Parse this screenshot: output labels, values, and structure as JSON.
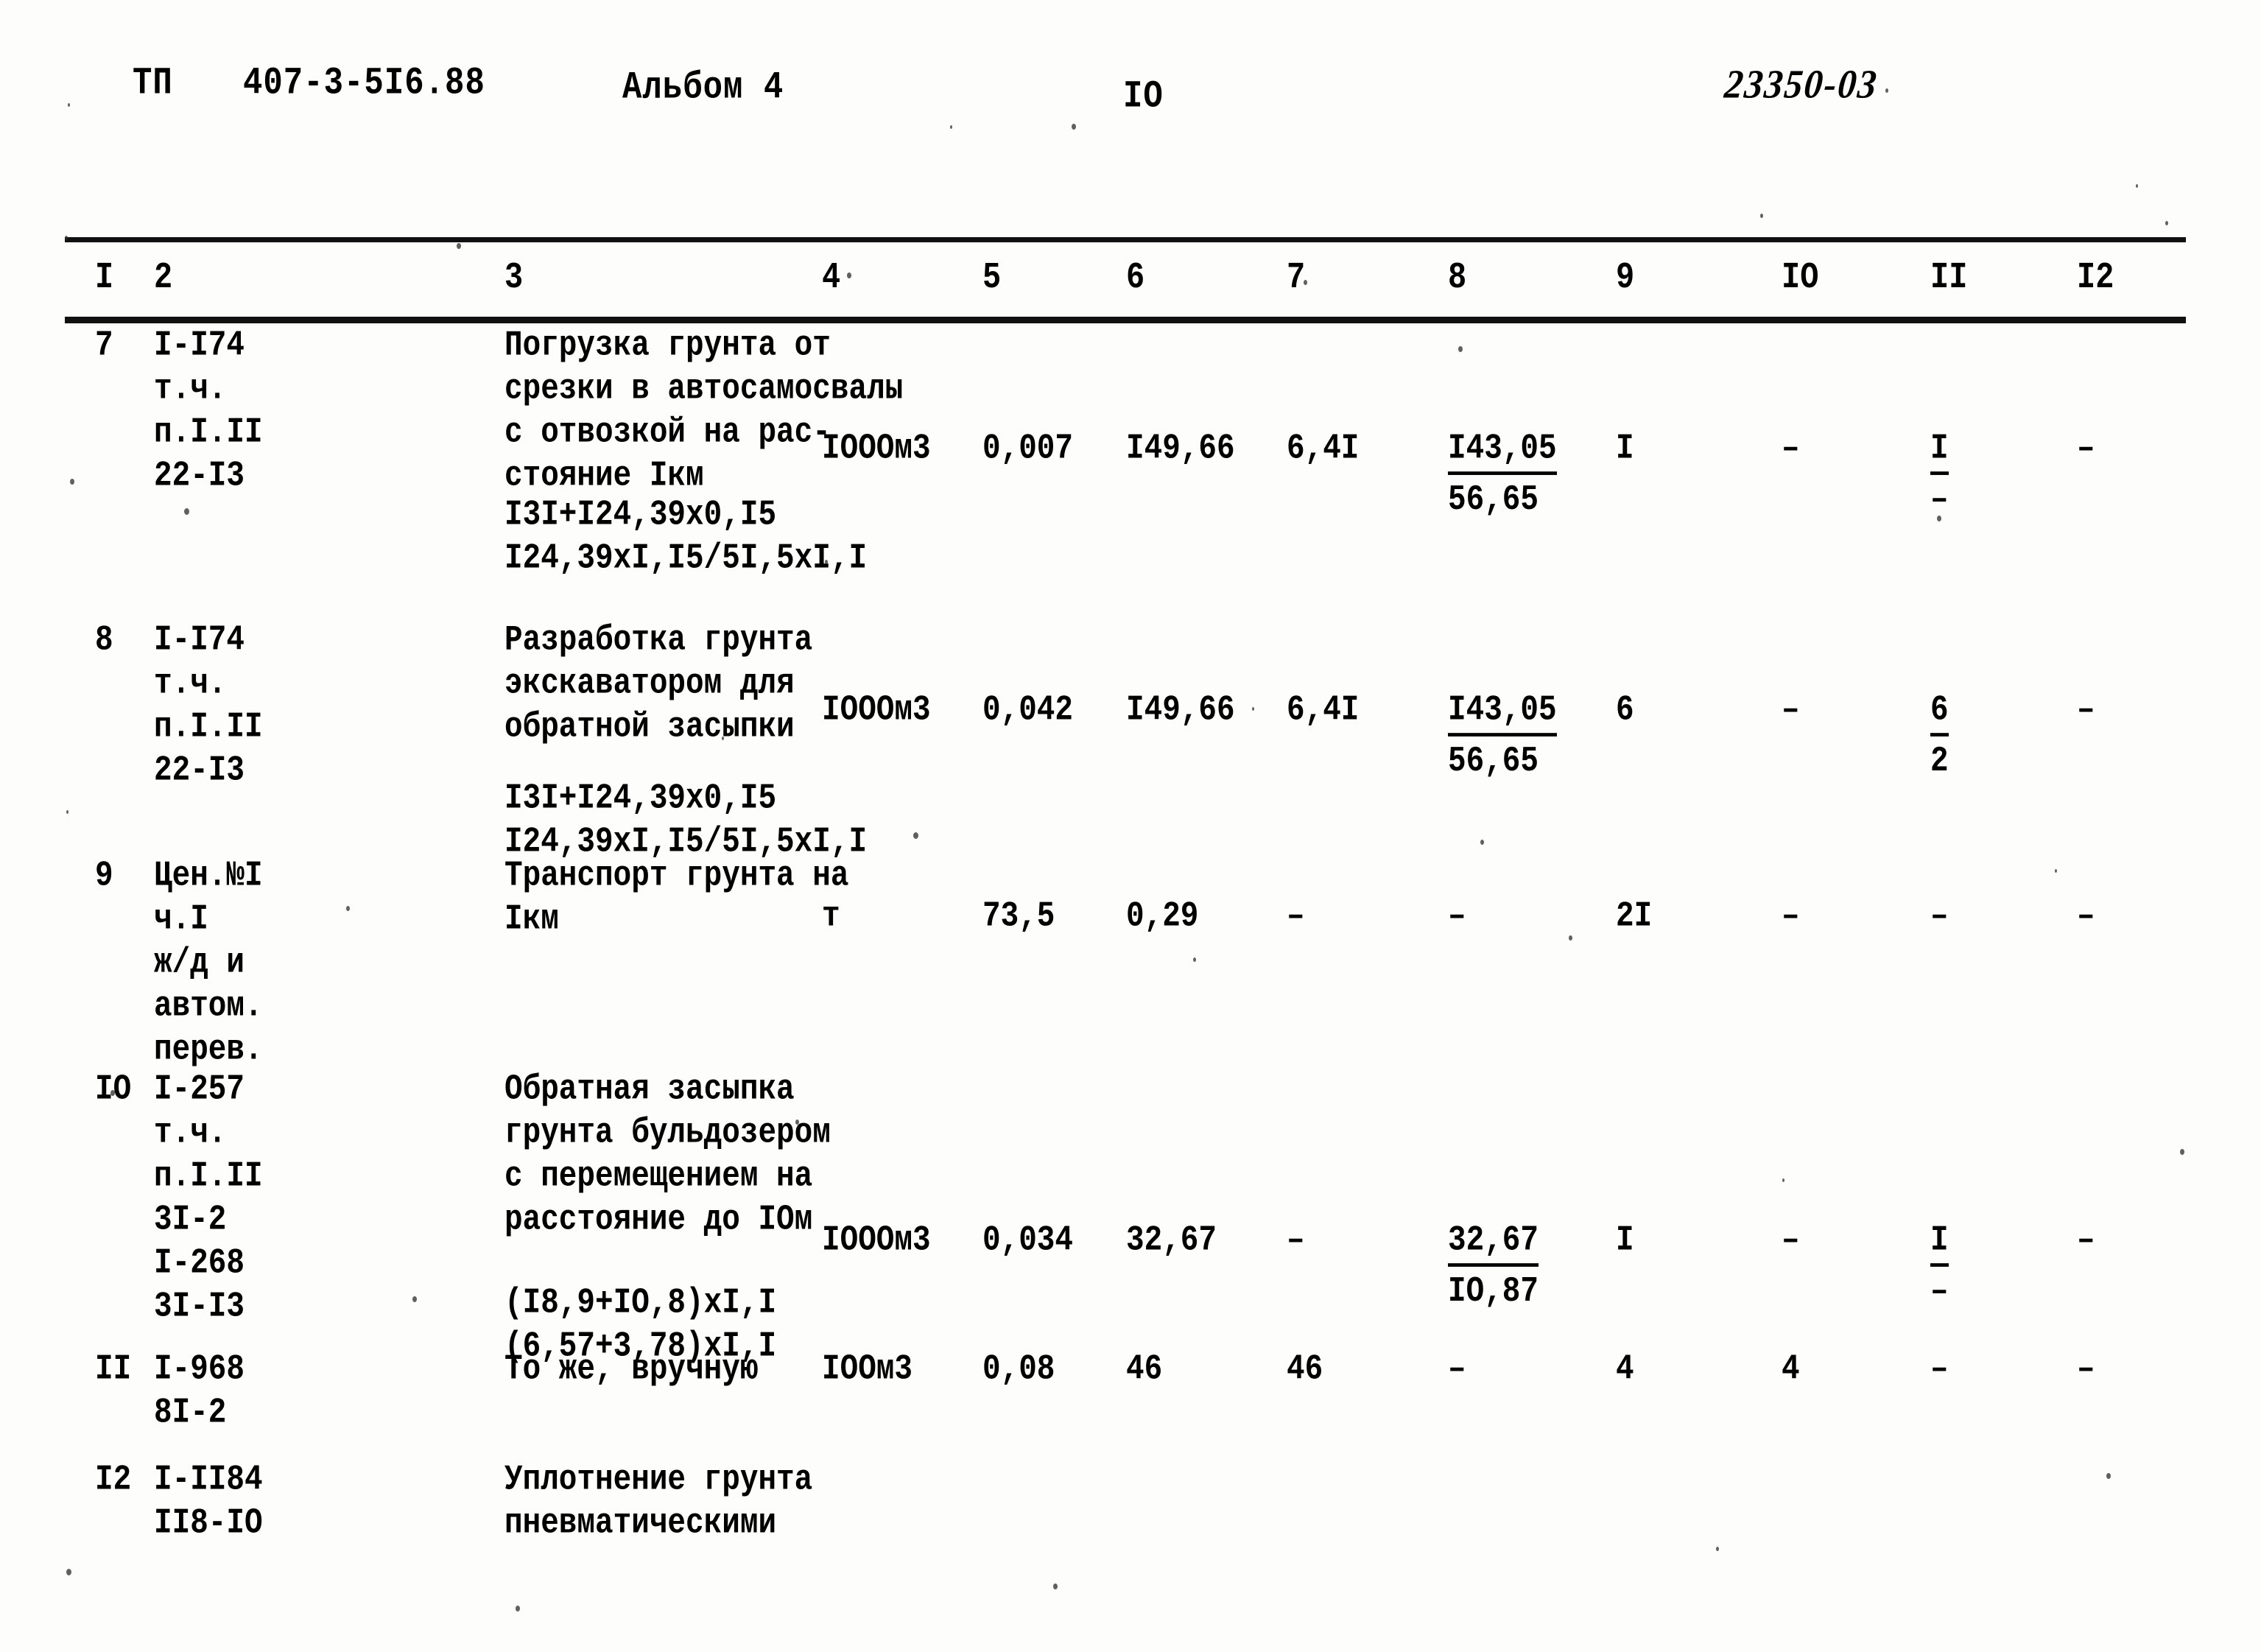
{
  "header": {
    "doc_type": "ТП",
    "doc_code": "407-3-5I6.88",
    "album": "Альбом 4",
    "page_number": "IO",
    "handwritten_mark": "23350-03"
  },
  "table": {
    "column_headers": [
      "I",
      "2",
      "3",
      "4",
      "5",
      "6",
      "7",
      "8",
      "9",
      "IO",
      "II",
      "I2"
    ],
    "rows": [
      {
        "n": "7",
        "code_lines": [
          "I-I74",
          "т.ч.",
          "п.I.II",
          "22-I3"
        ],
        "desc_lines": [
          "Погрузка грунта от",
          "срезки в автосамосвалы",
          "с отвозкой на рас-",
          "стояние Iкм"
        ],
        "formula_lines": [
          "I3I+I24,39x0,I5",
          "I24,39xI,I5/5I,5xI,I"
        ],
        "unit": "IOOOм3",
        "c5": "0,007",
        "c6": "I49,66",
        "c7": "6,4I",
        "c8_top": "I43,05",
        "c8_bot": "56,65",
        "c9": "I",
        "c10": "–",
        "c11_top": "I",
        "c11_bot": "–",
        "c12": "–"
      },
      {
        "n": "8",
        "code_lines": [
          "I-I74",
          "т.ч.",
          "п.I.II",
          "22-I3"
        ],
        "desc_lines": [
          "Разработка грунта",
          "экскаватором для",
          "обратной засыпки"
        ],
        "formula_lines": [
          "I3I+I24,39x0,I5",
          "I24,39xI,I5/5I,5xI,I"
        ],
        "unit": "IOOOм3",
        "c5": "0,042",
        "c6": "I49,66",
        "c7": "6,4I",
        "c8_top": "I43,05",
        "c8_bot": "56,65",
        "c9": "6",
        "c10": "–",
        "c11_top": "6",
        "c11_bot": "2",
        "c12": "–"
      },
      {
        "n": "9",
        "code_lines": [
          "Цен.№I",
          "ч.I",
          "ж/д и",
          "автом.",
          "перев."
        ],
        "desc_lines": [
          "Транспорт грунта на",
          "Iкм"
        ],
        "formula_lines": [],
        "unit": "т",
        "c5": "73,5",
        "c6": "0,29",
        "c7": "–",
        "c8_top": "–",
        "c8_bot": "",
        "c9": "2I",
        "c10": "–",
        "c11_top": "–",
        "c11_bot": "",
        "c12": "–"
      },
      {
        "n": "IO",
        "code_lines": [
          "I-257",
          "т.ч.",
          "п.I.II",
          "3I-2",
          "I-268",
          "3I-I3"
        ],
        "desc_lines": [
          "Обратная засыпка",
          "грунта бульдозером",
          "с перемещением на",
          "расстояние до IOм"
        ],
        "formula_lines": [
          "(I8,9+IO,8)xI,I",
          "(6,57+3,78)xI,I"
        ],
        "unit": "IOOOм3",
        "c5": "0,034",
        "c6": "32,67",
        "c7": "–",
        "c8_top": "32,67",
        "c8_bot": "IO,87",
        "c9": "I",
        "c10": "–",
        "c11_top": "I",
        "c11_bot": "–",
        "c12": "–"
      },
      {
        "n": "II",
        "code_lines": [
          "I-968",
          "8I-2"
        ],
        "desc_lines": [
          "То же, вручную"
        ],
        "formula_lines": [],
        "unit": "IOOм3",
        "c5": "0,08",
        "c6": "46",
        "c7": "46",
        "c8_top": "–",
        "c8_bot": "",
        "c9": "4",
        "c10": "4",
        "c11_top": "–",
        "c11_bot": "",
        "c12": "–"
      },
      {
        "n": "I2",
        "code_lines": [
          "I-II84",
          "II8-IO"
        ],
        "desc_lines": [
          "Уплотнение грунта",
          "пневматическими"
        ],
        "formula_lines": [],
        "unit": "",
        "c5": "",
        "c6": "",
        "c7": "",
        "c8_top": "",
        "c8_bot": "",
        "c9": "",
        "c10": "",
        "c11_top": "",
        "c11_bot": "",
        "c12": ""
      }
    ]
  }
}
